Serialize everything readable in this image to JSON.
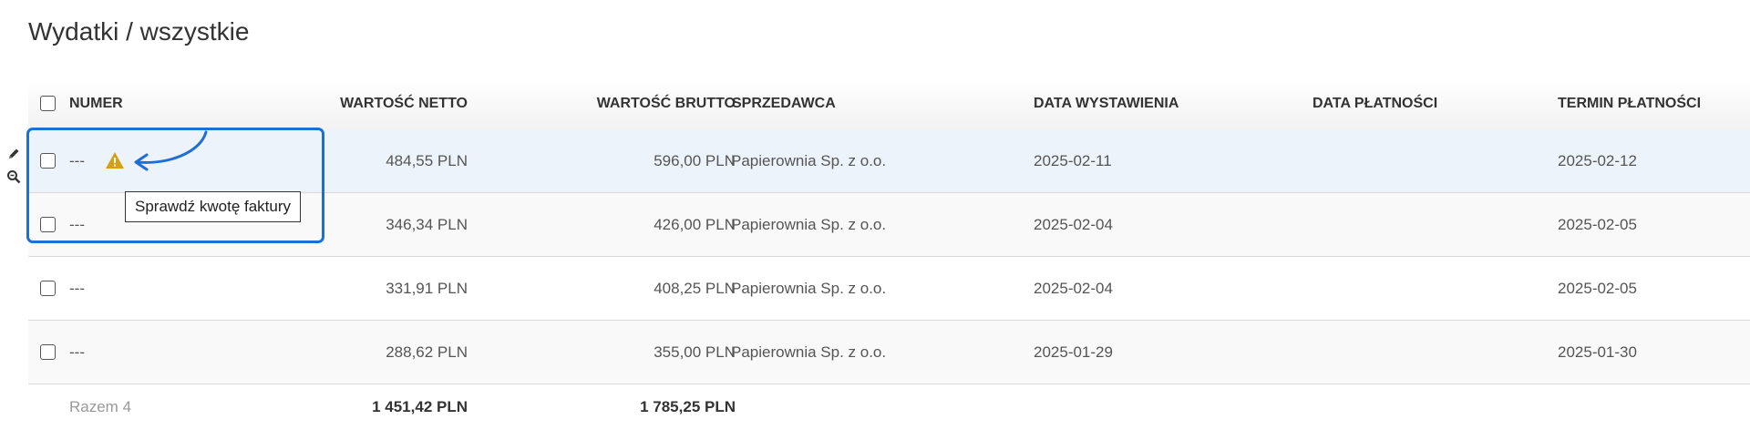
{
  "page_title": "Wydatki / wszystkie",
  "columns": {
    "numer": "NUMER",
    "netto": "WARTOŚĆ NETTO",
    "brutto": "WARTOŚĆ BRUTTO",
    "sprzedawca": "SPRZEDAWCA",
    "data_wystawienia": "DATA WYSTAWIENIA",
    "data_platnosci": "DATA PŁATNOŚCI",
    "termin_platnosci": "TERMIN PŁATNOŚCI"
  },
  "rows": [
    {
      "numer": "---",
      "netto": "484,55 PLN",
      "brutto": "596,00 PLN",
      "sprzedawca": "Papierownia Sp. z o.o.",
      "data_wystawienia": "2025-02-11",
      "data_platnosci": "",
      "termin_platnosci": "2025-02-12"
    },
    {
      "numer": "---",
      "netto": "346,34 PLN",
      "brutto": "426,00 PLN",
      "sprzedawca": "Papierownia Sp. z o.o.",
      "data_wystawienia": "2025-02-04",
      "data_platnosci": "",
      "termin_platnosci": "2025-02-05"
    },
    {
      "numer": "---",
      "netto": "331,91 PLN",
      "brutto": "408,25 PLN",
      "sprzedawca": "Papierownia Sp. z o.o.",
      "data_wystawienia": "2025-02-04",
      "data_platnosci": "",
      "termin_platnosci": "2025-02-05"
    },
    {
      "numer": "---",
      "netto": "288,62 PLN",
      "brutto": "355,00 PLN",
      "sprzedawca": "Papierownia Sp. z o.o.",
      "data_wystawienia": "2025-01-29",
      "data_platnosci": "",
      "termin_platnosci": "2025-01-30"
    }
  ],
  "footer": {
    "label": "Razem 4",
    "netto_total": "1 451,42 PLN",
    "brutto_total": "1 785,25 PLN"
  },
  "tooltip": "Sprawdź kwotę faktury",
  "colors": {
    "highlight_border": "#1e6ed6",
    "warning": "#d4a017",
    "selected_row": "#edf3fb"
  },
  "icons": {
    "row_edit": "pencil-icon",
    "row_preview": "zoom-icon",
    "warning": "warning-icon"
  }
}
